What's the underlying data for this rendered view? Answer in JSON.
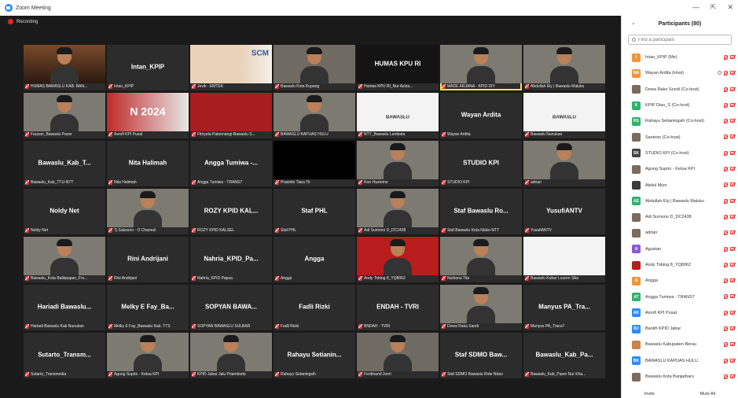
{
  "window": {
    "title": "Zoom Meeting",
    "controls": [
      "—",
      "⇱",
      "✕"
    ]
  },
  "recording": {
    "label": "Recording"
  },
  "gallery": {
    "tiles": [
      {
        "label": "HUMAS BAWASLU KAB. BAN...",
        "display": "",
        "kind": "pic-warm"
      },
      {
        "label": "Intan_KPIP",
        "display": "Intan_KPIP",
        "kind": "name"
      },
      {
        "label": "Jevik - EMTEK",
        "display": "SCM",
        "kind": "pic-slide"
      },
      {
        "label": "Bawaslu Kota Kupang",
        "display": "",
        "kind": "pic-room"
      },
      {
        "label": "Humas KPU RI_Nur Aziza...",
        "display": "HUMAS KPU RI",
        "kind": "pic-dark-text"
      },
      {
        "label": "MADE ARJANA - KPID DIY",
        "display": "",
        "kind": "pic-person-active"
      },
      {
        "label": "Abdullah Ely | Bawaslu Maluku",
        "display": "",
        "kind": "pic-person"
      },
      {
        "label": "Fauzan_Bawaslu Paser",
        "display": "",
        "kind": "pic-person"
      },
      {
        "label": "Asrofi KPI Pusat",
        "display": "N 2024",
        "kind": "pic-banner"
      },
      {
        "label": "Fitriyela Patoenangi-Bawaslu S...",
        "display": "",
        "kind": "pic-red"
      },
      {
        "label": "BAWASLU KAPUAS HULU",
        "display": "",
        "kind": "pic-person"
      },
      {
        "label": "NTT_Bawaslu Lembata",
        "display": "BAWASLU",
        "kind": "pic-logo"
      },
      {
        "label": "Wayan Ardita",
        "display": "Wayan Ardita",
        "kind": "name"
      },
      {
        "label": "Bawaslu Nunukan",
        "display": "BAWASLU",
        "kind": "pic-logo"
      },
      {
        "label": "Bawaslu_Kab_TTU-NTT",
        "display": "Bawaslu_Kab_T...",
        "kind": "name"
      },
      {
        "label": "Nita Halimah",
        "display": "Nita Halimah",
        "kind": "name"
      },
      {
        "label": "Angga Tumiwa - TRANS7",
        "display": "Angga Tumiwa -...",
        "kind": "name"
      },
      {
        "label": "Prasetio Tiara Tir",
        "display": "",
        "kind": "pic-black"
      },
      {
        "label": "Rori Hastomo",
        "display": "",
        "kind": "pic-person"
      },
      {
        "label": "STUDIO KPI",
        "display": "STUDIO KPI",
        "kind": "name"
      },
      {
        "label": "adrian",
        "display": "",
        "kind": "pic-person"
      },
      {
        "label": "Noldy Net",
        "display": "Noldy Net",
        "kind": "name"
      },
      {
        "label": "Tj Saksono - O Channel",
        "display": "",
        "kind": "pic-person"
      },
      {
        "label": "ROZY KPID KALSEL",
        "display": "ROZY KPID KAL...",
        "kind": "name"
      },
      {
        "label": "Staf PHL",
        "display": "Staf PHL",
        "kind": "name"
      },
      {
        "label": "Adi Sumono D_DC2438",
        "display": "",
        "kind": "pic-person"
      },
      {
        "label": "Staf Bawaslu Kota Nisko-NTT",
        "display": "Staf Bawaslu Ro...",
        "kind": "name"
      },
      {
        "label": "YusufiANTV",
        "display": "YusufiANTV",
        "kind": "name"
      },
      {
        "label": "Bawaslu_Kota Balikpapan_Fro...",
        "display": "",
        "kind": "pic-person"
      },
      {
        "label": "Rini Andrijani",
        "display": "Rini Andrijani",
        "kind": "name"
      },
      {
        "label": "Nahria_KPID Papua",
        "display": "Nahria_KPID_Pa...",
        "kind": "name"
      },
      {
        "label": "Angga",
        "display": "Angga",
        "kind": "name"
      },
      {
        "label": "Andy Tobing 8_YQ8062",
        "display": "",
        "kind": "pic-red-person"
      },
      {
        "label": "Nurliana Tita",
        "display": "",
        "kind": "pic-person"
      },
      {
        "label": "Bawaslu Kubar Louren Siks",
        "display": "",
        "kind": "pic-logo2"
      },
      {
        "label": "Hariadi Bawaslu Kab Nunukan",
        "display": "Hariadi Bawaslu...",
        "kind": "name"
      },
      {
        "label": "Melky E Fay_Bawaslu Kab. TTS",
        "display": "Melky E Fay_Ba...",
        "kind": "name"
      },
      {
        "label": "SOPYAN BAWASLU SULBAR",
        "display": "SOPYAN BAWA...",
        "kind": "name"
      },
      {
        "label": "Fadli Rizki",
        "display": "Fadli Rizki",
        "kind": "name"
      },
      {
        "label": "BNDAH - TVRI",
        "display": "ENDAH - TVRI",
        "kind": "name"
      },
      {
        "label": "Dewa Raka Sandi",
        "display": "",
        "kind": "pic-person"
      },
      {
        "label": "Manyus PA_Trans7",
        "display": "Manyus PA_Tra...",
        "kind": "name"
      },
      {
        "label": "Sutarto_Transmedia",
        "display": "Sutarto_Transm...",
        "kind": "name"
      },
      {
        "label": "Agung Suprio - Ketua KPI",
        "display": "",
        "kind": "pic-person"
      },
      {
        "label": "KPID Jabar Jalu Priambodo",
        "display": "",
        "kind": "pic-person"
      },
      {
        "label": "Rahayu Setaningsih",
        "display": "Rahayu Setianin...",
        "kind": "name"
      },
      {
        "label": "Ferdinand Jonri",
        "display": "",
        "kind": "pic-room"
      },
      {
        "label": "Staf SDMO Bawaslu Rote Ndao",
        "display": "Staf SDMO Baw...",
        "kind": "name"
      },
      {
        "label": "Bawaslu_Kab_Paser Nur Kha...",
        "display": "Bawaslu_Kab_Pa...",
        "kind": "name"
      }
    ]
  },
  "participants": {
    "title": "Participants (80)",
    "search_placeholder": "Find a participant",
    "items": [
      {
        "name": "Intan_KPIP (Me)",
        "initials": "I",
        "color": "#f0953a"
      },
      {
        "name": "Wayan Ardita (Host)",
        "initials": "WA",
        "color": "#f0953a"
      },
      {
        "name": "Dewa Rako Sondi (Co-host)",
        "initials": "",
        "color": "#7a6b5d"
      },
      {
        "name": "KPIP Dian_S (Co-host)",
        "initials": "K",
        "color": "#2fb36b"
      },
      {
        "name": "Rahayu Setianingsih (Co-host)",
        "initials": "RS",
        "color": "#2fb36b"
      },
      {
        "name": "Santoso (Co-host)",
        "initials": "",
        "color": "#7a6b5d"
      },
      {
        "name": "STUDIO KPI (Co-host)",
        "initials": "SK",
        "color": "#444"
      },
      {
        "name": "Agung Suprio - Ketua KPI",
        "initials": "",
        "color": "#7a6b5d"
      },
      {
        "name": "Abdul Muin",
        "initials": "",
        "color": "#3a3a3a"
      },
      {
        "name": "Abdullah Ely | Bawaslu Maluku",
        "initials": "AE",
        "color": "#2fb36b"
      },
      {
        "name": "Adi Sumono D_DC2438",
        "initials": "",
        "color": "#7a6b5d"
      },
      {
        "name": "adrian",
        "initials": "",
        "color": "#7a6b5d"
      },
      {
        "name": "Agustan",
        "initials": "A",
        "color": "#8a5bd6"
      },
      {
        "name": "Andy Tobing 8_YQ8062",
        "initials": "",
        "color": "#b81d1d"
      },
      {
        "name": "Angga",
        "initials": "A",
        "color": "#f0953a"
      },
      {
        "name": "Angga Tumiwa - TRANS7",
        "initials": "AT",
        "color": "#2fb36b"
      },
      {
        "name": "Asrofi KPI Pusat",
        "initials": "AK",
        "color": "#2d8cff"
      },
      {
        "name": "Banith KPID Jabar",
        "initials": "BJ",
        "color": "#2d8cff"
      },
      {
        "name": "Bawaslu Kabupaten Berau",
        "initials": "",
        "color": "#c9844e"
      },
      {
        "name": "BAWASLU KAPUAS HULU",
        "initials": "BK",
        "color": "#2d8cff"
      },
      {
        "name": "Bawaslu Kota Banjarbaru",
        "initials": "",
        "color": "#7a6b5d"
      }
    ],
    "footer": {
      "invite": "Invite",
      "mute_all": "Mute All"
    }
  }
}
